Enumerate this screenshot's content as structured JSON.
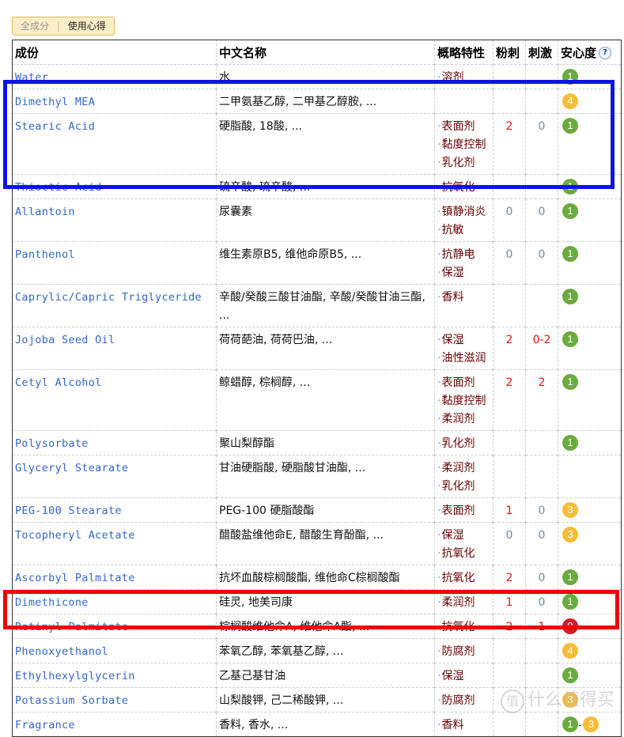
{
  "tabs": {
    "inactive_label": "全成分",
    "separator": "|",
    "active_label": "使用心得"
  },
  "table": {
    "headers": {
      "inci": "成份",
      "chinese": "中文名称",
      "features": "概略特性",
      "acne": "粉刺",
      "irritation": "刺激",
      "safety": "安心度",
      "help_icon": "?"
    },
    "rows": [
      {
        "inci": "Water",
        "cn": "水",
        "features": [
          "溶剂"
        ],
        "acne": "",
        "irritation": "",
        "safety": [
          "1"
        ],
        "safety_colors": [
          "green"
        ]
      },
      {
        "inci": "Dimethyl MEA",
        "cn": "二甲氨基乙醇, 二甲基乙醇胺, ...",
        "features": [],
        "acne": "",
        "irritation": "",
        "safety": [
          "4"
        ],
        "safety_colors": [
          "orange"
        ]
      },
      {
        "inci": "Stearic Acid",
        "cn": "硬脂酸, 18酸, ...",
        "features": [
          "表面剂",
          "黏度控制",
          "乳化剂"
        ],
        "acne": "2",
        "irritation": "0",
        "safety": [
          "1"
        ],
        "safety_colors": [
          "green"
        ]
      },
      {
        "inci": "Thioctic Acid",
        "cn": "硫辛酸, 琉辛酸, ...",
        "features": [
          "抗氧化"
        ],
        "acne": "",
        "irritation": "",
        "safety": [
          "1"
        ],
        "safety_colors": [
          "green"
        ]
      },
      {
        "inci": "Allantoin",
        "cn": "尿囊素",
        "features": [
          "镇静消炎",
          "抗敏"
        ],
        "acne": "0",
        "irritation": "0",
        "safety": [
          "1"
        ],
        "safety_colors": [
          "green"
        ]
      },
      {
        "inci": "Panthenol",
        "cn": "维生素原B5, 维他命原B5, ...",
        "features": [
          "抗静电",
          "保湿"
        ],
        "acne": "0",
        "irritation": "0",
        "safety": [
          "1"
        ],
        "safety_colors": [
          "green"
        ]
      },
      {
        "inci": "Caprylic/Capric Triglyceride",
        "cn": "辛酸/癸酸三酸甘油酯, 辛酸/癸酸甘油三酯, ...",
        "features": [
          "香料"
        ],
        "acne": "",
        "irritation": "",
        "safety": [
          "1"
        ],
        "safety_colors": [
          "green"
        ]
      },
      {
        "inci": "Jojoba Seed Oil",
        "cn": "荷荷葩油, 荷荷巴油, ...",
        "features": [
          "保湿",
          "油性滋润"
        ],
        "acne": "2",
        "irritation": "0-2",
        "safety": [
          "1"
        ],
        "safety_colors": [
          "green"
        ]
      },
      {
        "inci": "Cetyl Alcohol",
        "cn": "鲸蜡醇, 棕榈醇, ...",
        "features": [
          "表面剂",
          "黏度控制",
          "柔润剂"
        ],
        "acne": "2",
        "irritation": "2",
        "safety": [
          "1"
        ],
        "safety_colors": [
          "green"
        ]
      },
      {
        "inci": "Polysorbate",
        "cn": "聚山梨醇酯",
        "features": [
          "乳化剂"
        ],
        "acne": "",
        "irritation": "",
        "safety": [
          "1"
        ],
        "safety_colors": [
          "green"
        ]
      },
      {
        "inci": "Glyceryl Stearate",
        "cn": "甘油硬脂酸, 硬脂酸甘油酯, ...",
        "features": [
          "柔润剂",
          "乳化剂"
        ],
        "acne": "",
        "irritation": "",
        "safety": [],
        "safety_colors": []
      },
      {
        "inci": "PEG-100 Stearate",
        "cn": "PEG-100 硬脂酸酯",
        "features": [
          "表面剂"
        ],
        "acne": "1",
        "irritation": "0",
        "safety": [
          "3"
        ],
        "safety_colors": [
          "orange"
        ]
      },
      {
        "inci": "Tocopheryl Acetate",
        "cn": "醋酸盐维他命E, 醋酸生育酚酯, ...",
        "features": [
          "保湿",
          "抗氧化"
        ],
        "acne": "0",
        "irritation": "0",
        "safety": [
          "3"
        ],
        "safety_colors": [
          "orange"
        ]
      },
      {
        "inci": "Ascorbyl Palmitate",
        "cn": "抗坏血酸棕榈酸酯, 维他命C棕榈酸酯",
        "features": [
          "抗氧化"
        ],
        "acne": "2",
        "irritation": "0",
        "safety": [
          "1"
        ],
        "safety_colors": [
          "green"
        ]
      },
      {
        "inci": "Dimethicone",
        "cn": "硅灵, 地美司康",
        "features": [
          "柔润剂"
        ],
        "acne": "1",
        "irritation": "0",
        "safety": [
          "1"
        ],
        "safety_colors": [
          "green"
        ]
      },
      {
        "inci": "Retinyl Palmitate",
        "cn": "棕榈酸维他命A, 维他命A酯, ...",
        "features": [
          "抗氧化"
        ],
        "acne": "2",
        "irritation": "1",
        "safety": [
          "9"
        ],
        "safety_colors": [
          "red"
        ]
      },
      {
        "inci": "Phenoxyethanol",
        "cn": "苯氧乙醇, 苯氧基乙醇, ...",
        "features": [
          "防腐剂"
        ],
        "acne": "",
        "irritation": "",
        "safety": [
          "4"
        ],
        "safety_colors": [
          "orange"
        ]
      },
      {
        "inci": "Ethylhexylglycerin",
        "cn": "乙基己基甘油",
        "features": [
          "保湿"
        ],
        "acne": "",
        "irritation": "",
        "safety": [
          "1"
        ],
        "safety_colors": [
          "green"
        ]
      },
      {
        "inci": "Potassium Sorbate",
        "cn": "山梨酸钾, 己二稀酸钾, ...",
        "features": [
          "防腐剂"
        ],
        "acne": "",
        "irritation": "",
        "safety": [
          "3"
        ],
        "safety_colors": [
          "orange"
        ]
      },
      {
        "inci": "Fragrance",
        "cn": "香料, 香水, ...",
        "features": [
          "香料"
        ],
        "acne": "",
        "irritation": "",
        "safety": [
          "1",
          "3"
        ],
        "safety_colors": [
          "green",
          "orange"
        ]
      }
    ]
  },
  "highlights": {
    "blue_box_rows": [
      "Dimethyl MEA",
      "Stearic Acid",
      "Thioctic Acid"
    ],
    "red_box_rows": [
      "Retinyl Palmitate"
    ],
    "blue_color": "#0a14e6",
    "red_color": "#ee0000"
  },
  "watermark": {
    "circle_char": "值",
    "text": "什么值得买"
  },
  "colors": {
    "inci_link": "#3366cc",
    "feature_text": "#660000",
    "number_red": "#ee1111",
    "number_gray": "#6f8aa0",
    "badge_green": "#6aaa3f",
    "badge_orange": "#f8bc3a",
    "badge_red": "#d01c2c",
    "tab_bg": "#fdecc8"
  }
}
